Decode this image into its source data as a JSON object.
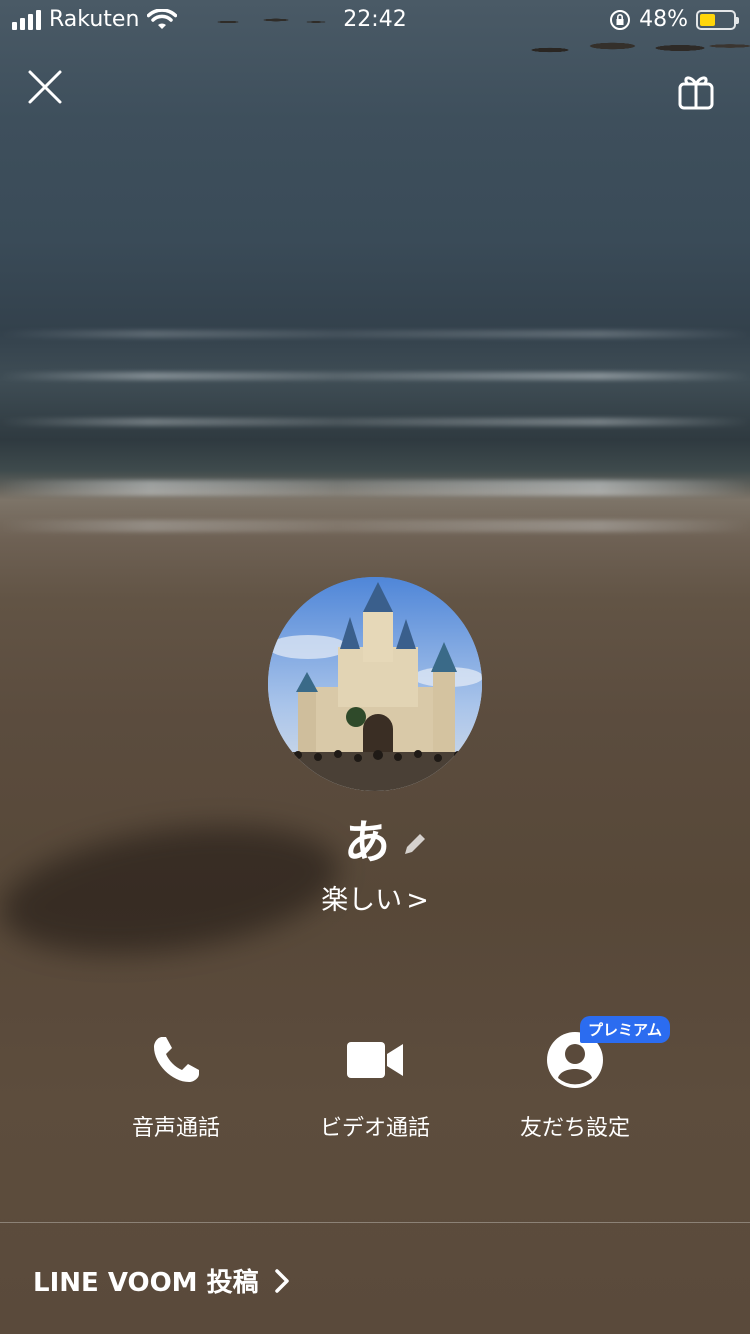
{
  "status_bar": {
    "carrier": "Rakuten",
    "time": "22:42",
    "battery_percent": "48%",
    "battery_level": 0.48,
    "battery_color": "#ffd60a"
  },
  "header": {
    "close_icon": "close-icon",
    "gift_icon": "gift-icon"
  },
  "profile": {
    "name": "あ",
    "status_message": "楽しい",
    "avatar_description_icon": "avatar-photo"
  },
  "actions": [
    {
      "label": "音声通話",
      "icon": "phone-icon"
    },
    {
      "label": "ビデオ通話",
      "icon": "video-camera-icon"
    },
    {
      "label": "友だち設定",
      "icon": "person-icon",
      "badge": "プレミアム"
    }
  ],
  "footer": {
    "voom_label": "LINE VOOM 投稿"
  },
  "colors": {
    "premium_badge": "#2b6cf0",
    "text": "#ffffff"
  }
}
